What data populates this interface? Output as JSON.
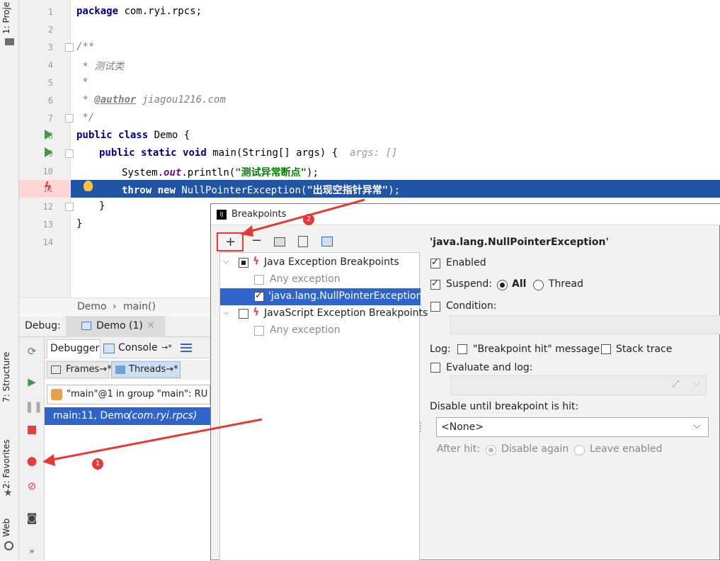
{
  "left_tabs": {
    "project": "1: Proje",
    "structure": "7: Structure",
    "favorites": "2: Favorites",
    "web": "Web"
  },
  "editor": {
    "lines": [
      "1",
      "2",
      "3",
      "4",
      "5",
      "6",
      "7",
      "8",
      "9",
      "10",
      "11",
      "12",
      "13",
      "14"
    ],
    "package_kw": "package",
    "package_name": " com.ryi.rpcs;",
    "doc_open": "/**",
    "doc_title": " * 测试类",
    "doc_star": " *",
    "doc_author_tag": "@author",
    "doc_author": " jiagou1216.com",
    "doc_close": " */",
    "class_line": [
      "public",
      "class",
      " Demo {"
    ],
    "main_line": [
      "public",
      "static",
      "void",
      " main(String[] args) {  ",
      "args: []"
    ],
    "println_pre": "System.",
    "println_field": "out",
    "println_mid": ".println(",
    "println_str": "\"测试异常断点\"",
    "println_end": ");",
    "throw_kw": "throw",
    "new_kw": "new",
    "throw_cls": " NullPointerException(",
    "throw_str": "\"出现空指针异常\"",
    "throw_end": ");",
    "close_method": "}",
    "close_class": "}"
  },
  "breadcrumb": {
    "class": "Demo",
    "sep": "›",
    "method": "main()"
  },
  "debug": {
    "label": "Debug:",
    "session_tab": "Demo (1)",
    "close": "×",
    "tab_debugger": "Debugger",
    "tab_console": "Console",
    "console_arrow": "→*",
    "frames": "Frames→*",
    "threads": "Threads→*",
    "thread": "\"main\"@1 in group \"main\": RU",
    "frame_loc": "main:11, Demo",
    "frame_pkg": "(com.ryi.rpcs)"
  },
  "dialog": {
    "title": "Breakpoints",
    "toolbar": {
      "add": "+",
      "remove": "−"
    },
    "tree": [
      {
        "label": "Java Exception Breakpoints",
        "state": "partial",
        "level": 0
      },
      {
        "label": "Any exception",
        "state": "off",
        "level": 1,
        "disabled": true
      },
      {
        "label": "'java.lang.NullPointerException'",
        "state": "on",
        "level": 1,
        "selected": true
      },
      {
        "label": "JavaScript Exception Breakpoints",
        "state": "off",
        "level": 0
      },
      {
        "label": "Any exception",
        "state": "off",
        "level": 1,
        "disabled": true
      }
    ],
    "detail_title": "'java.lang.NullPointerException'",
    "enabled": "Enabled",
    "suspend": "Suspend:",
    "all": "All",
    "thread": "Thread",
    "condition": "Condition:",
    "log": "Log:",
    "bp_hit_msg": "\"Breakpoint hit\" message",
    "stack_trace": "Stack trace",
    "evaluate": "Evaluate and log:",
    "disable_until": "Disable until breakpoint is hit:",
    "none": "<None>",
    "after_hit": "After hit:",
    "disable_again": "Disable again",
    "leave_enabled": "Leave enabled"
  },
  "annotations": {
    "one": "1",
    "two": "2"
  }
}
